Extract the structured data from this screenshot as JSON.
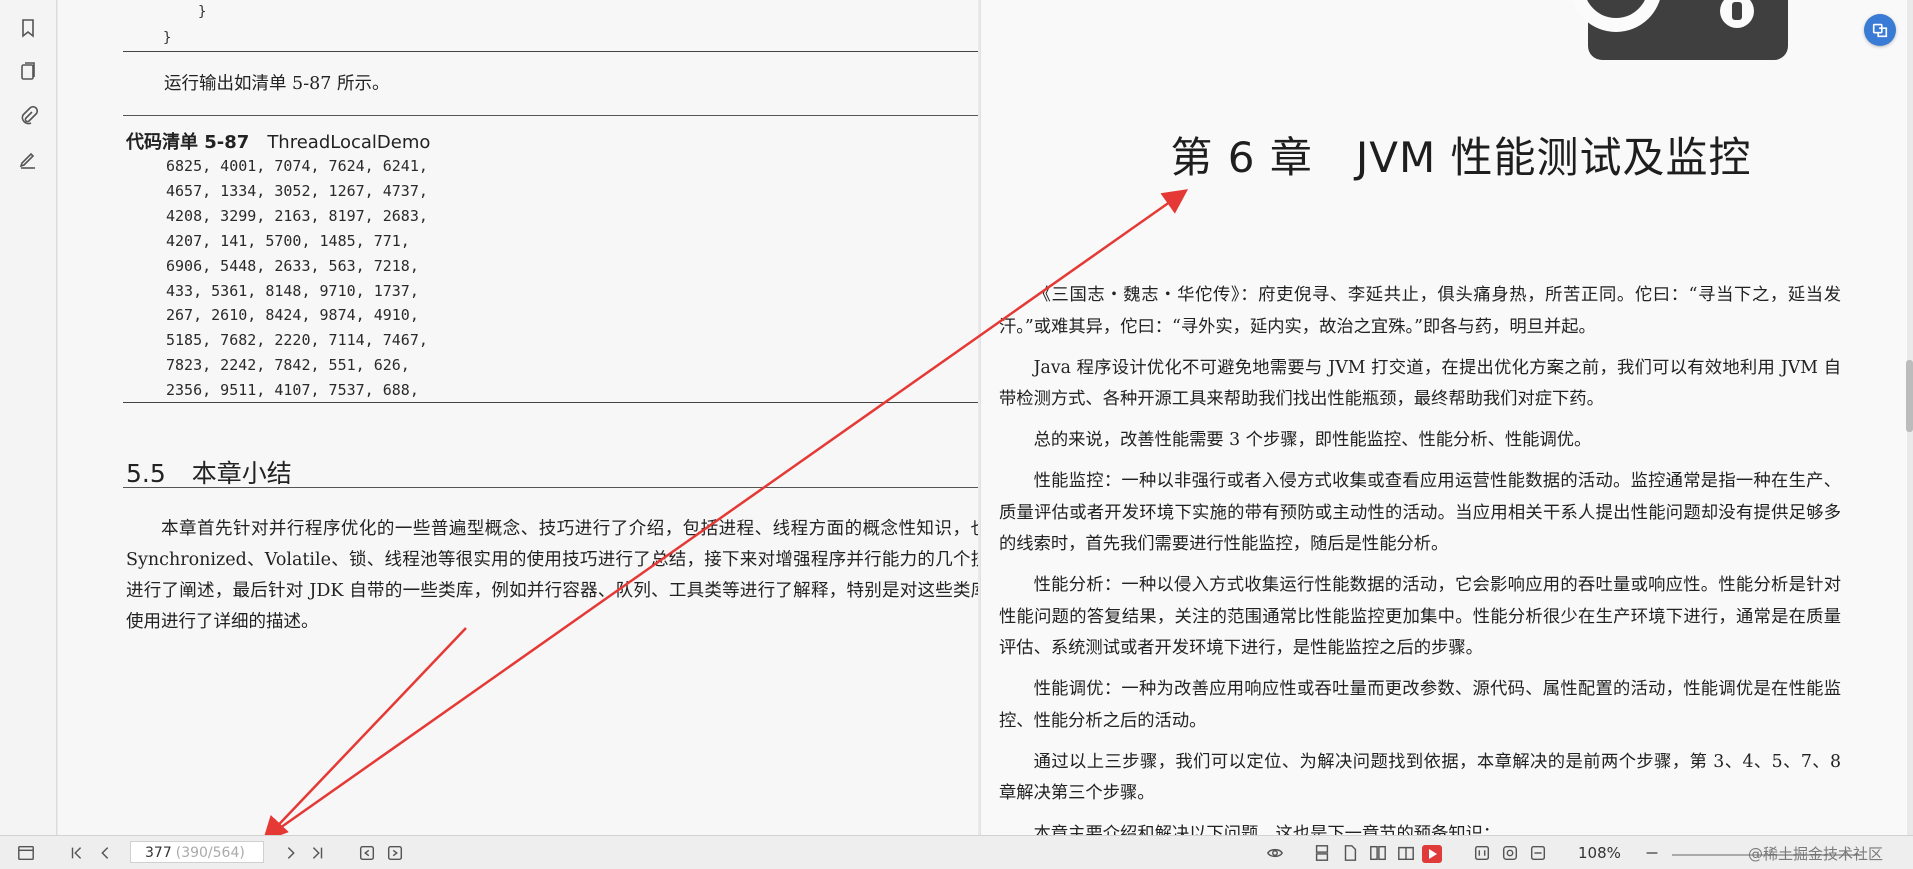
{
  "left_rail": {
    "icons": [
      "bookmark-icon",
      "pages-icon",
      "attachment-icon",
      "signature-icon"
    ]
  },
  "left_page": {
    "code_tail": [
      "}",
      "}"
    ],
    "run_output_text": "运行输出如清单 5-87 所示。",
    "listing_label": "代码清单 5-87",
    "listing_name": "ThreadLocalDemo",
    "code_lines": [
      "6825, 4001, 7074, 7624, 6241,",
      "4657, 1334, 3052, 1267, 4737,",
      "4208, 3299, 2163, 8197, 2683,",
      "4207, 141, 5700, 1485, 771,",
      "6906, 5448, 2633, 563, 7218,",
      "433, 5361, 8148, 9710, 1737,",
      "267, 2610, 8424, 9874, 4910,",
      "5185, 7682, 2220, 7114, 7467,",
      "7823, 2242, 7842, 551, 626,",
      "2356, 9511, 4107, 7537, 688,"
    ],
    "section_number": "5.5",
    "section_title": "本章小结",
    "summary": "本章首先针对并行程序优化的一些普遍型概念、技巧进行了介绍，包括进程、线程方面的概念性知识，也对 Synchronized、Volatile、锁、线程池等很实用的使用技巧进行了总结，接下来对增强程序并行能力的几个技巧进行了阐述，最后针对 JDK 自带的一些类库，例如并行容器、队列、工具类等进行了解释，特别是对这些类库的使用进行了详细的描述。"
  },
  "right_page": {
    "chapter_title": "第 6 章　JVM 性能测试及监控",
    "paragraphs": [
      "《三国志・魏志・华佗传》：府吏倪寻、李延共止，俱头痛身热，所苦正同。佗曰：“寻当下之，延当发汗。”或难其异，佗曰：“寻外实，延内实，故治之宜殊。”即各与药，明旦并起。",
      "Java 程序设计优化不可避免地需要与 JVM 打交道，在提出优化方案之前，我们可以有效地利用 JVM 自带检测方式、各种开源工具来帮助我们找出性能瓶颈，最终帮助我们对症下药。",
      "总的来说，改善性能需要 3 个步骤，即性能监控、性能分析、性能调优。",
      "性能监控：一种以非强行或者入侵方式收集或查看应用运营性能数据的活动。监控通常是指一种在生产、质量评估或者开发环境下实施的带有预防或主动性的活动。当应用相关干系人提出性能问题却没有提供足够多的线索时，首先我们需要进行性能监控，随后是性能分析。",
      "性能分析：一种以侵入方式收集运行性能数据的活动，它会影响应用的吞吐量或响应性。性能分析是针对性能问题的答复结果，关注的范围通常比性能监控更加集中。性能分析很少在生产环境下进行，通常是在质量评估、系统测试或者开发环境下进行，是性能监控之后的步骤。",
      "性能调优：一种为改善应用响应性或吞吐量而更改参数、源代码、属性配置的活动，性能调优是在性能监控、性能分析之后的活动。",
      "通过以上三步骤，我们可以定位、为解决问题找到依据，本章解决的是前两个步骤，第 3、4、5、7、8 章解决第三个步骤。",
      "本章主要介绍和解决以下问题，这也是下一章节的预备知识："
    ]
  },
  "toolbar": {
    "current_page": "377",
    "page_of": "(390/564)",
    "zoom": "108%",
    "watermark": "@稀土掘金技术社区"
  },
  "colors": {
    "annotation_arrow": "#e53935",
    "accent": "#3a7bd5"
  }
}
